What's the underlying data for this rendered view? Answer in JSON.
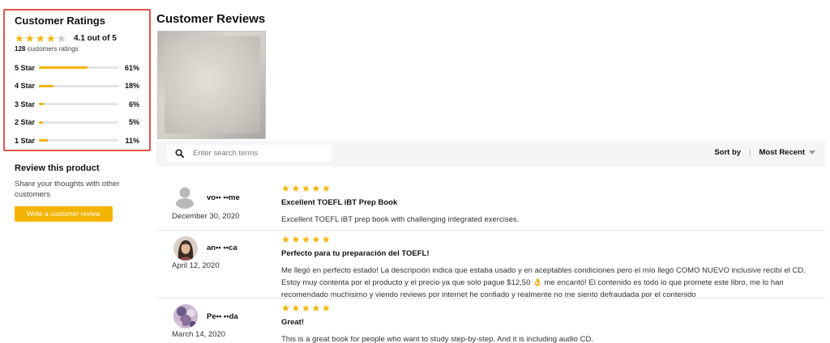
{
  "ratings": {
    "title": "Customer Ratings",
    "average_stars": 4.1,
    "summary": "4.1 out of 5",
    "count": "128",
    "count_suffix": "customers ratings",
    "breakdown": [
      {
        "label": "5 Star",
        "percent_text": "61%",
        "fraction": 0.61
      },
      {
        "label": "4 Star",
        "percent_text": "18%",
        "fraction": 0.18
      },
      {
        "label": "3 Star",
        "percent_text": "6%",
        "fraction": 0.06
      },
      {
        "label": "2 Star",
        "percent_text": "5%",
        "fraction": 0.05
      },
      {
        "label": "1 Star",
        "percent_text": "11%",
        "fraction": 0.11
      }
    ],
    "highlight_color": "#e0534a",
    "star_color": "#f5b301"
  },
  "review_product": {
    "title": "Review this product",
    "text": "Share your thoughts with other customers",
    "button_label": "Write a customer review"
  },
  "reviews_section": {
    "title": "Customer Reviews",
    "search_placeholder": "Enter search terms",
    "sort_label": "Sort by",
    "sort_separator": "|",
    "sort_value": "Most Recent"
  },
  "reviews": [
    {
      "reviewer": "vo•• ••me",
      "date": "December 30, 2020",
      "stars": 5,
      "title": "Excellent TOEFL iBT Prep Book",
      "text": "Excellent TOEFL iBT prep book with challenging integrated exercises.",
      "avatar": "default-user-icon"
    },
    {
      "reviewer": "an•• ••ca",
      "date": "April 12, 2020",
      "stars": 5,
      "title": "Perfecto para tu preparación del TOEFL!",
      "text": "Me llegó en perfecto estado! La descripción indica que estaba usado y en aceptables condiciones pero el mío llegó COMO NUEVO inclusive recibí el CD. Estoy muy contenta por el producto y el precio ya que solo pague $12,50 👌 me encantó! El contenido es todo lo que promete este libro, me lo han recomendado muchisimo y viendo reviews por internet he confiado y realmente no me siento defraudada por el contenido",
      "avatar": "user-photo"
    },
    {
      "reviewer": "Pe•• ••da",
      "date": "March 14, 2020",
      "stars": 5,
      "title": "Great!",
      "text": "This is a great book for people who want to study step-by-step. And it is including audio CD.",
      "avatar": "user-photo"
    }
  ]
}
